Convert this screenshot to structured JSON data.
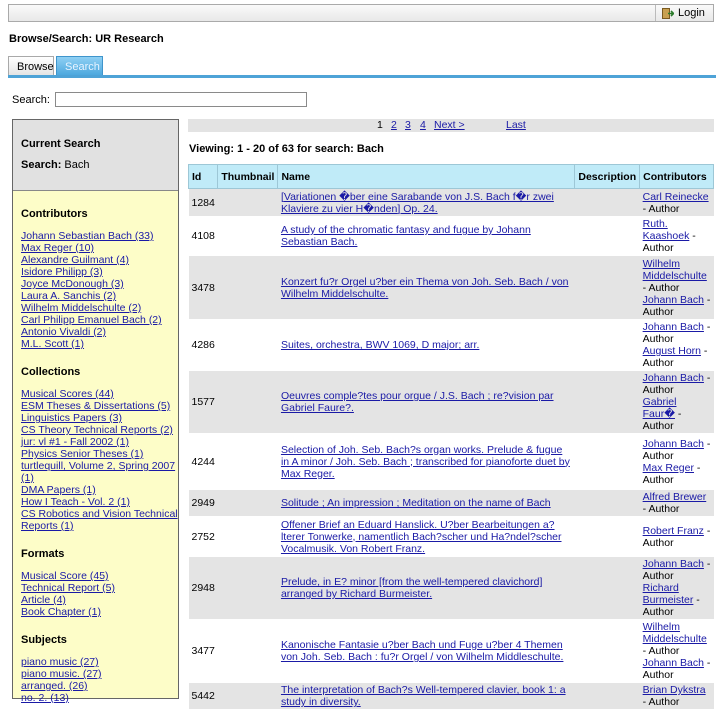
{
  "header": {
    "login_label": "Login"
  },
  "page_title": "Browse/Search: UR Research",
  "tabs": [
    {
      "label": "Browse"
    },
    {
      "label": "Search"
    }
  ],
  "search": {
    "label": "Search:",
    "value": "",
    "placeholder": ""
  },
  "sidebar": {
    "current_search_heading": "Current Search",
    "search_label": "Search:",
    "search_term": "Bach",
    "contributors_heading": "Contributors",
    "contributors": [
      "Johann Sebastian Bach (33)",
      "Max Reger (10)",
      "Alexandre Guilmant (4)",
      "Isidore Philipp (3)",
      "Joyce McDonough (3)",
      "Laura A. Sanchis (2)",
      "Wilhelm Middelschulte (2)",
      "Carl Philipp Emanuel Bach (2)",
      "Antonio Vivaldi (2)",
      "M.L. Scott (1)"
    ],
    "collections_heading": "Collections",
    "collections": [
      "Musical Scores (44)",
      "ESM Theses & Dissertations (5)",
      "Linguistics Papers (3)",
      "CS Theory Technical Reports (2)",
      "jur: vl #1 - Fall 2002 (1)",
      "Physics Senior Theses (1)",
      "turtlequill, Volume 2, Spring 2007",
      "(1)",
      "DMA Papers (1)",
      "How I Teach - Vol. 2 (1)",
      "CS Robotics and Vision Technical",
      "Reports (1)"
    ],
    "formats_heading": "Formats",
    "formats": [
      "Musical Score (45)",
      "Technical Report (5)",
      "Article (4)",
      "Book Chapter (1)"
    ],
    "subjects_heading": "Subjects",
    "subjects": [
      "piano music (27)",
      "piano music. (27)",
      "arranged. (26)",
      "no. 2. (13)"
    ]
  },
  "pager": {
    "pages": [
      "1",
      "2",
      "3",
      "4"
    ],
    "next_label": "Next >",
    "last_label": "Last"
  },
  "viewing_text": "Viewing: 1 - 20 of 63 for search: Bach",
  "table": {
    "headers": [
      "Id",
      "Thumbnail",
      "Name",
      "Description",
      "Contributors"
    ],
    "rows": [
      {
        "id": "1284",
        "name": "[Variationen �ber eine Sarabande von J.S. Bach f�r zwei Klaviere zu vier H�nden] Op. 24.",
        "contributors": [
          [
            "Carl Reinecke",
            "Author"
          ]
        ]
      },
      {
        "id": "4108",
        "name": "A study of the chromatic fantasy and fugue by Johann Sebastian Bach.",
        "contributors": [
          [
            "Ruth. Kaashoek",
            "Author"
          ]
        ]
      },
      {
        "id": "3478",
        "name": "Konzert fu?r Orgel u?ber ein Thema von Joh. Seb. Bach / von Wilhelm Middelschulte.",
        "contributors": [
          [
            "Wilhelm Middelschulte",
            "Author"
          ],
          [
            "Johann Bach",
            "Author"
          ]
        ]
      },
      {
        "id": "4286",
        "name": "Suites, orchestra, BWV 1069, D major; arr.",
        "contributors": [
          [
            "Johann Bach",
            "Author"
          ],
          [
            "August Horn",
            "Author"
          ]
        ]
      },
      {
        "id": "1577",
        "name": "Oeuvres comple?tes pour orgue / J.S. Bach ; re?vision par Gabriel Faure?.",
        "contributors": [
          [
            "Johann Bach",
            "Author"
          ],
          [
            "Gabriel Faur�",
            "Author"
          ]
        ]
      },
      {
        "id": "4244",
        "name": "Selection of Joh. Seb. Bach?s organ works. Prelude & fugue in A minor / Joh. Seb. Bach ; transcribed for pianoforte duet by Max Reger.",
        "contributors": [
          [
            "Johann Bach",
            "Author"
          ],
          [
            "Max Reger",
            "Author"
          ]
        ]
      },
      {
        "id": "2949",
        "name": "Solitude ; An impression ; Meditation on the name of Bach",
        "contributors": [
          [
            "Alfred Brewer",
            "Author"
          ]
        ]
      },
      {
        "id": "2752",
        "name": "Offener Brief an Eduard Hanslick. U?ber Bearbeitungen a?lterer Tonwerke, namentlich Bach?scher und Ha?ndel?scher Vocalmusik. Von Robert Franz.",
        "contributors": [
          [
            "Robert Franz",
            "Author"
          ]
        ]
      },
      {
        "id": "2948",
        "name": "Prelude, in E? minor [from the well-tempered clavichord] arranged by Richard Burmeister.",
        "contributors": [
          [
            "Johann Bach",
            "Author"
          ],
          [
            "Richard Burmeister",
            "Author"
          ]
        ]
      },
      {
        "id": "3477",
        "name": "Kanonische Fantasie u?ber Bach und Fuge u?ber 4 Themen von Joh. Seb. Bach : fu?r Orgel / von Wilhelm Middleschulte.",
        "contributors": [
          [
            "Wilhelm Middelschulte",
            "Author"
          ],
          [
            "Johann Bach",
            "Author"
          ]
        ]
      },
      {
        "id": "5442",
        "name": "The interpretation of Bach?s Well-tempered clavier, book 1: a study in diversity.",
        "contributors": [
          [
            "Brian Dykstra",
            "Author"
          ]
        ]
      }
    ]
  }
}
